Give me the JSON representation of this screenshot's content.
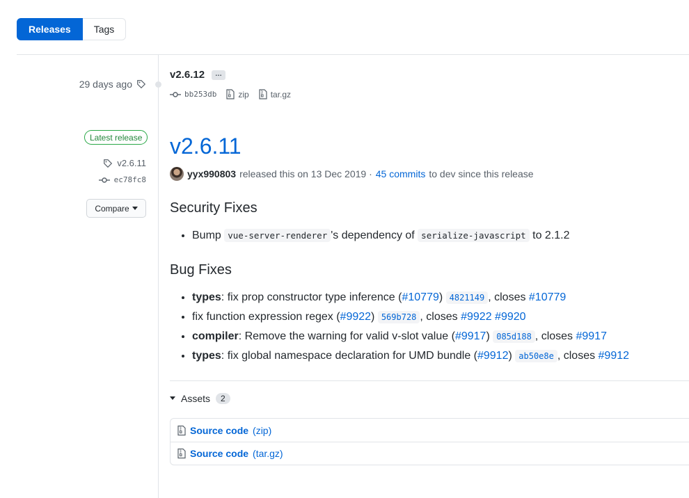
{
  "tabs": [
    {
      "label": "Releases",
      "active": true
    },
    {
      "label": "Tags",
      "active": false
    }
  ],
  "older_release": {
    "age": "29 days ago",
    "tag": "v2.6.12",
    "ellipsis": "…",
    "commit": "bb253db",
    "zip": "zip",
    "targz": "tar.gz"
  },
  "sidebar": {
    "latest_badge": "Latest release",
    "tag": "v2.6.11",
    "commit": "ec78fc8",
    "compare_label": "Compare"
  },
  "release": {
    "title": "v2.6.11",
    "author": "yyx990803",
    "released_text": "released this on 13 Dec 2019 ·",
    "commits_link": "45 commits",
    "since_text": "to dev since this release"
  },
  "security": {
    "heading": "Security Fixes",
    "items": [
      {
        "pre": "Bump ",
        "code1": "vue-server-renderer",
        "mid": "'s dependency of ",
        "code2": "serialize-javascript",
        "post": " to 2.1.2"
      }
    ]
  },
  "bugs": {
    "heading": "Bug Fixes",
    "items": [
      {
        "bold": "types",
        "text": ": fix prop constructor type inference (",
        "pr": "#10779",
        "close_paren": ")",
        "sha": "4821149",
        "closes": ", closes ",
        "issues": [
          "#10779"
        ]
      },
      {
        "bold": "",
        "text": "fix function expression regex (",
        "pr": "#9922",
        "close_paren": ")",
        "sha": "569b728",
        "closes": ", closes ",
        "issues": [
          "#9922",
          "#9920"
        ]
      },
      {
        "bold": "compiler",
        "text": ": Remove the warning for valid v-slot value (",
        "pr": "#9917",
        "close_paren": ")",
        "sha": "085d188",
        "closes": ", closes ",
        "issues": [
          "#9917"
        ]
      },
      {
        "bold": "types",
        "text": ": fix global namespace declaration for UMD bundle (",
        "pr": "#9912",
        "close_paren": ")",
        "sha": "ab50e8e",
        "closes": ", closes ",
        "issues": [
          "#9912"
        ]
      }
    ]
  },
  "assets": {
    "label": "Assets",
    "count": "2",
    "items": [
      {
        "name": "Source code",
        "ext": "(zip)"
      },
      {
        "name": "Source code",
        "ext": "(tar.gz)"
      }
    ]
  },
  "colors": {
    "accent": "#0366d6",
    "latest": "#28a745",
    "muted": "#586069"
  }
}
